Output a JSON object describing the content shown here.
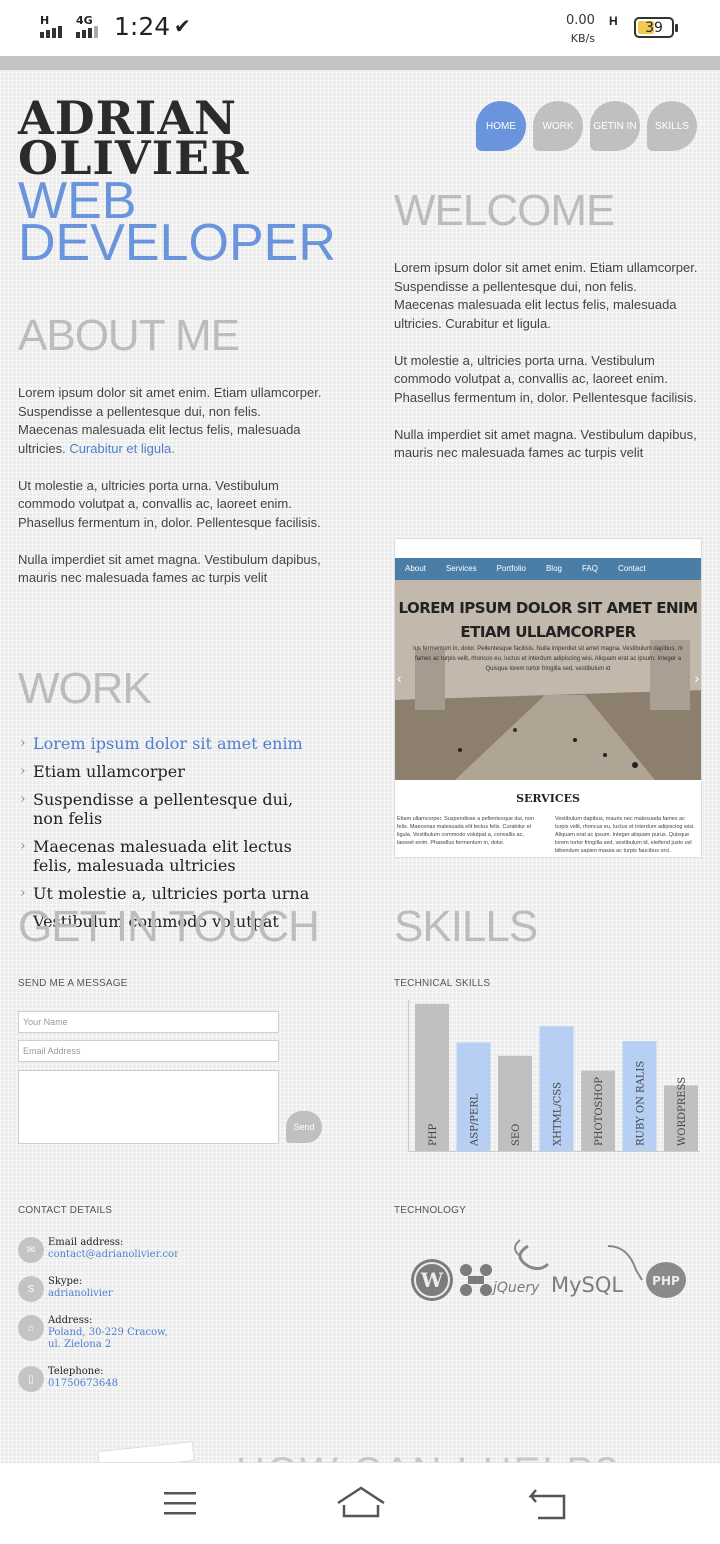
{
  "status_bar": {
    "signal1_label": "H",
    "signal2_label": "4G",
    "time": "1:24",
    "check": "✔",
    "speed_value": "0.00",
    "speed_unit": "KB/s",
    "network_h": "H",
    "battery": "39"
  },
  "header": {
    "name_line1": "ADRIAN",
    "name_line2": "OLIVIER",
    "role_line1": "WEB",
    "role_line2": "DEVELOPER"
  },
  "nav": {
    "items": [
      {
        "label": "HOME",
        "active": true
      },
      {
        "label": "WORK",
        "active": false
      },
      {
        "label": "GETIN IN",
        "active": false
      },
      {
        "label": "SKILLS",
        "active": false
      }
    ]
  },
  "welcome": {
    "title": "WELCOME",
    "p1": "Lorem ipsum dolor sit amet enim. Etiam ullamcorper. Suspendisse a pellentesque dui, non felis. Maecenas malesuada elit lectus felis, malesuada ultricies. Curabitur et ligula.",
    "p2": "Ut molestie a, ultricies porta urna. Vestibulum commodo volutpat a, convallis ac, laoreet enim. Phasellus fermentum in, dolor. Pellentesque facilisis.",
    "p3": "Nulla imperdiet sit amet magna. Vestibulum dapibus, mauris nec malesuada fames ac turpis velit"
  },
  "about": {
    "title": "ABOUT ME",
    "p1": "Lorem ipsum dolor sit amet enim. Etiam ullamcorper. Suspendisse a pellentesque dui, non felis. Maecenas malesuada elit lectus felis, malesuada ultricies.",
    "p1_link": "Curabitur et ligula.",
    "p2": "Ut molestie a, ultricies porta urna. Vestibulum commodo volutpat a, convallis ac, laoreet enim. Phasellus fermentum in, dolor. Pellentesque facilisis.",
    "p3": "Nulla imperdiet sit amet magna. Vestibulum dapibus, mauris nec malesuada fames ac turpis velit"
  },
  "work": {
    "title": "WORK",
    "items": [
      "Lorem ipsum dolor sit amet enim",
      "Etiam ullamcorper",
      "Suspendisse a pellentesque dui, non felis",
      "Maecenas malesuada elit lectus felis, malesuada ultricies",
      "Ut molestie a, ultricies porta urna",
      "Vestibulum commodo volutpat"
    ]
  },
  "preview": {
    "nav": [
      "About",
      "Services",
      "Portfolio",
      "Blog",
      "FAQ",
      "Contact"
    ],
    "title_line1": "LOREM IPSUM DOLOR SIT AMET ENIM",
    "title_line2": "ETIAM ULLAMCORPER",
    "text_line1": "lus fermentum in, dolor. Pellentesque facilisis. Nulla imperdiet sit amet magna. Vestibulum dapibus, m",
    "text_line2": "fames ac turpis velit, rhoncus eu, luctus et interdum adipiscing wisi. Aliquam erat ac ipsum. Integer a",
    "text_line3": "Quisque lorem tortor fringilla sed, vestibulum id",
    "services": "SERVICES",
    "col1": "Etiam ullamcorper. Suspendisse a pellentesque dui, non felis. Maecenas malesuada elit lectus felis. Curabitur et ligula. Vestibulum commodo volutpat a, convallis ac, laoreet enim. Phasellus fermentum in, dolor.",
    "col2": "Vestibulum dapibus, mauris nec malesuada fames ac turpis velit, rhoncus eu, luctus et interdum adipiscing wisi. Aliquam erat ac ipsum. Integer aliquam purus. Quisque lorem tortor fringilla sed, vestibulum id, eleifend justo vel bibendum sapien massa ac turpis faucibus orci."
  },
  "get_in_touch": {
    "title": "GET IN TOUCH",
    "send_label": "SEND ME A MESSAGE",
    "name_placeholder": "Your Name",
    "email_placeholder": "Email Address",
    "send_button": "Send"
  },
  "skills": {
    "title": "SKILLS",
    "tech_label": "TECHNICAL SKILLS",
    "technology_label": "TECHNOLOGY"
  },
  "chart_data": {
    "type": "bar",
    "categories": [
      "PHP",
      "ASP/PERL",
      "SEO",
      "XHTML/CSS",
      "PHOTOSHOP",
      "RUBY ON RALIS",
      "WORDPRESS"
    ],
    "values": [
      100,
      74,
      65,
      85,
      55,
      75,
      45
    ],
    "colors": [
      "#c0c0c0",
      "#b7cff3",
      "#c0c0c0",
      "#b7cff3",
      "#c0c0c0",
      "#b7cff3",
      "#c0c0c0"
    ],
    "ylim": [
      0,
      100
    ]
  },
  "contact": {
    "label": "CONTACT DETAILS",
    "email_label": "Email address:",
    "email_value": "contact@adrianolivier.com",
    "skype_label": "Skype:",
    "skype_value": "adrianolivier",
    "address_label": "Address:",
    "address_line1": "Poland, 30-229 Cracow,",
    "address_line2": "ul. Zielona 2",
    "phone_label": "Telephone:",
    "phone_value": "01750673648"
  },
  "technology": {
    "logos": [
      "WordPress",
      "Joomla",
      "jQuery",
      "MySQL",
      "PHP"
    ],
    "jquery_text": "jQuery",
    "mysql_text": "MySQL",
    "php_text": "PHP"
  },
  "next_section": {
    "title": "HOW CAN I HELP?"
  },
  "android_nav": {
    "icons": [
      "menu-icon",
      "home-icon",
      "back-icon"
    ]
  }
}
